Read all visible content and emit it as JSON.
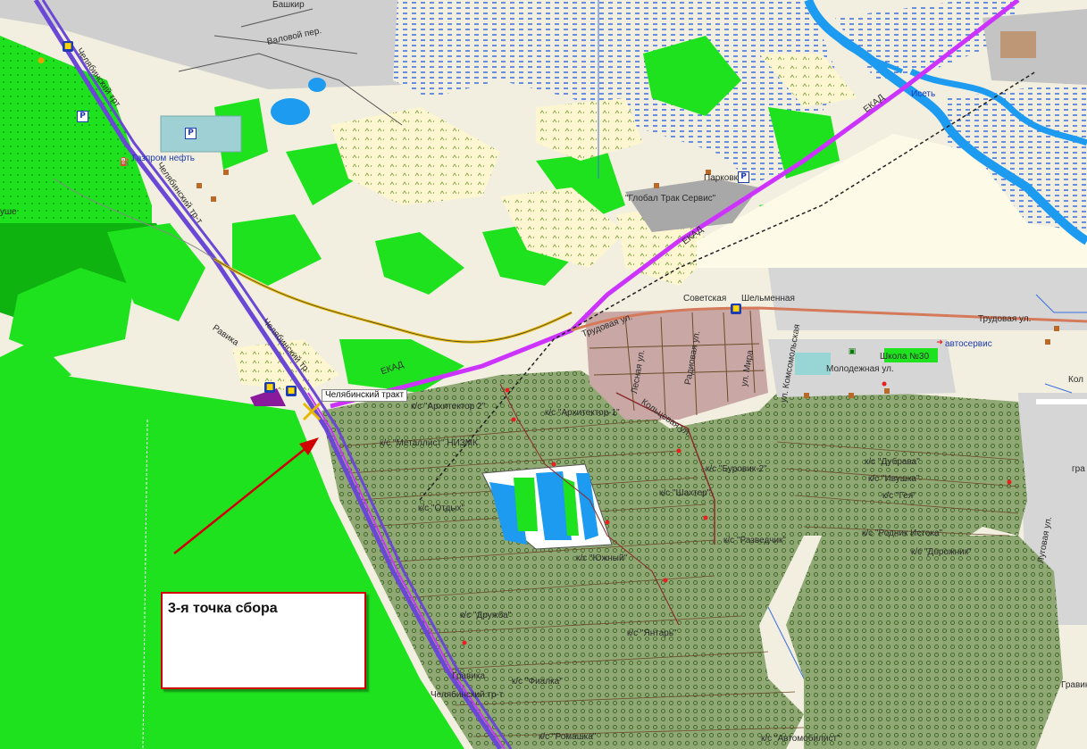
{
  "map": {
    "colors": {
      "background": "#f2efe0",
      "forest": "#1fe21f",
      "dark_forest": "#0fb30f",
      "gardens": "#8fa874",
      "water": "#1d9bf0",
      "wetland": "#3a6ee0",
      "highway": "#cc33ff",
      "road": "#6b47d6",
      "residential": "#c9a7a4",
      "callout_border": "#d00000"
    },
    "streets": {
      "chelyabinsk_trakt_top": "Челябинский трт",
      "chelyabinsk_trakt_mid": "Челябинский тр-т",
      "chelyabinsk_trakt_left": "Челябинский тр",
      "chelyabinsk_trakt_bottom": "Челябинский тр-т",
      "chelyabinsk_trakt_tag": "Челябинский тракт",
      "valovoy": "Валовой пер.",
      "bashkir": "Башкир",
      "ekad_upper": "ЕКАД",
      "ekad_mid": "ЕКАД",
      "ekad_low": "ЕКАД",
      "trudovaya_left": "Трудовая ул.",
      "trudovaya_right": "Трудовая ул.",
      "sovetskaya": "Советская",
      "shelemennaya": "Шельменная",
      "molodezhnaya": "Молодежная ул.",
      "lugovaya": "Луговая ул.",
      "kolcevaya": "Кольцевая ул.",
      "radiovaya": "Радиовая ул.",
      "mira": "ул. Мира",
      "lesnaya": "Лесная ул.",
      "komsomolskaya": "ул. Комсомольская",
      "gravika_top": "Равика",
      "gravika_left": "Гравика",
      "gravika_bottom": "Гравика",
      "kol": "Кол",
      "gr": "гра"
    },
    "places": {
      "gazprom": "Газпром нефть",
      "parking": "Парковка",
      "global_truck": "\"Глобал Трак Сервис\"",
      "school": "Школа №30",
      "autoservice": "автосервис",
      "iset": "Исеть",
      "ushe": "уше"
    },
    "gardens": {
      "arkhitektor2": "к/с \"Архитектор 2\"",
      "arkhitektor1": "к/с \"Архитектор-1\"",
      "metallist": "к/с \"Металлист\" НИЗМК",
      "otdykh": "к/с \"Отдых\"",
      "burovik2": "к/с \"Буровик-2\"",
      "shakhter": "к/с \"Шахтер\"",
      "yuzhny": "к/с \"Южный\"",
      "razvedchik": "к/с \"Разведчик\"",
      "druzhba": "к/с \"Дружба\"",
      "yantar": "к/с \"Янтарь\"",
      "fialka": "к/с \"Фиалка\"",
      "romashka": "к/с \"Ромашка\"",
      "avtomobilist": "к/с \"Автомобилист\"",
      "dubrava": "к/с \"Дубрава\"",
      "ivushka": "к/с \"Ивушка\"",
      "gel": "к/с \"Гея\"",
      "rodnik": "к/с \"Родник Истока\"",
      "dorozhnik": "к/с \"Дорожник\""
    },
    "parking_symbol": "P",
    "callout_text": "3-я точка сбора"
  }
}
